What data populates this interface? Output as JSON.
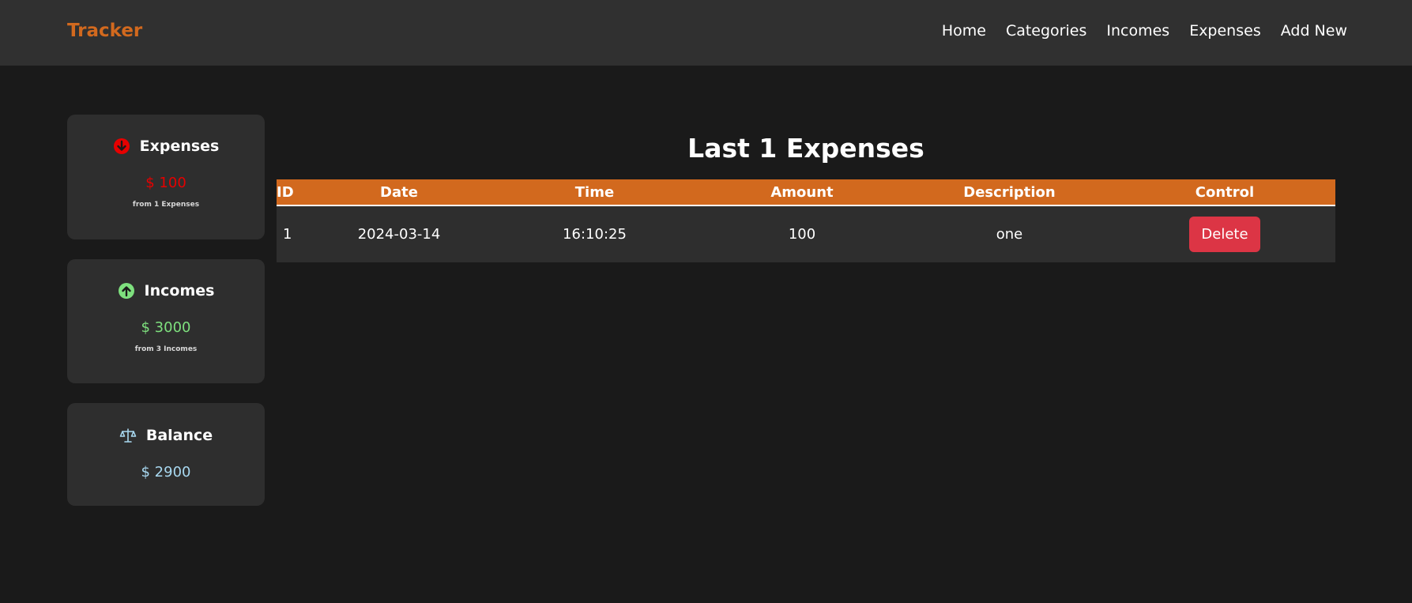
{
  "navbar": {
    "brand": "Tracker",
    "links": [
      "Home",
      "Categories",
      "Incomes",
      "Expenses",
      "Add New"
    ],
    "brand_color": "#d2691e"
  },
  "cards": {
    "expenses": {
      "title": "Expenses",
      "amount": "$ 100",
      "subtitle": "from 1 Expenses",
      "icon": "arrow-down-circle-icon",
      "color": "#e60000"
    },
    "incomes": {
      "title": "Incomes",
      "amount": "$ 3000",
      "subtitle": "from 3 Incomes",
      "icon": "arrow-up-circle-icon",
      "color": "#7ee07e"
    },
    "balance": {
      "title": "Balance",
      "amount": "$ 2900",
      "icon": "scale-icon",
      "color": "#a8d8f0"
    }
  },
  "main": {
    "title": "Last 1 Expenses",
    "table": {
      "headers": [
        "ID",
        "Date",
        "Time",
        "Amount",
        "Description",
        "Control"
      ],
      "rows": [
        {
          "id": "1",
          "date": "2024-03-14",
          "time": "16:10:25",
          "amount": "100",
          "description": "one",
          "control_label": "Delete"
        }
      ],
      "header_color": "#d2691e",
      "delete_color": "#dc3545"
    }
  }
}
